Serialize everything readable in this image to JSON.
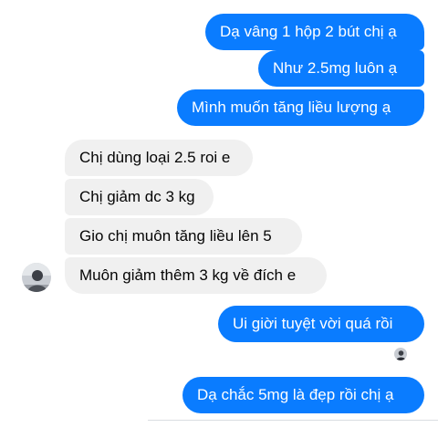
{
  "messages": [
    {
      "id": "m1",
      "direction": "outgoing",
      "text": "Dạ vâng 1 hộp 2 bút chị ạ"
    },
    {
      "id": "m2",
      "direction": "outgoing",
      "text": "Như 2.5mg luôn ạ"
    },
    {
      "id": "m3",
      "direction": "outgoing",
      "text": "Mình muốn tăng liều lượng ạ"
    },
    {
      "id": "m4",
      "direction": "incoming",
      "text": "Chị dùng loại 2.5 roi e"
    },
    {
      "id": "m5",
      "direction": "incoming",
      "text": "Chị giảm dc 3 kg"
    },
    {
      "id": "m6",
      "direction": "incoming",
      "text": "Gio chị muôn tăng liều lên 5"
    },
    {
      "id": "m7",
      "direction": "incoming",
      "text": "Muôn giảm thêm 3 kg về đích e"
    },
    {
      "id": "m8",
      "direction": "outgoing",
      "text": "Ui giời tuyệt vời quá rồi"
    },
    {
      "id": "m9",
      "direction": "outgoing",
      "text": "Dạ chắc 5mg là đẹp rồi chị ạ"
    }
  ],
  "colors": {
    "outgoing_bubble": "#0a7cff",
    "incoming_bubble": "#f0f0f0",
    "outgoing_text": "#ffffff",
    "incoming_text": "#050505"
  },
  "icons": {
    "contact_avatar": "contact-avatar",
    "seen_indicator": "seen-avatar"
  }
}
